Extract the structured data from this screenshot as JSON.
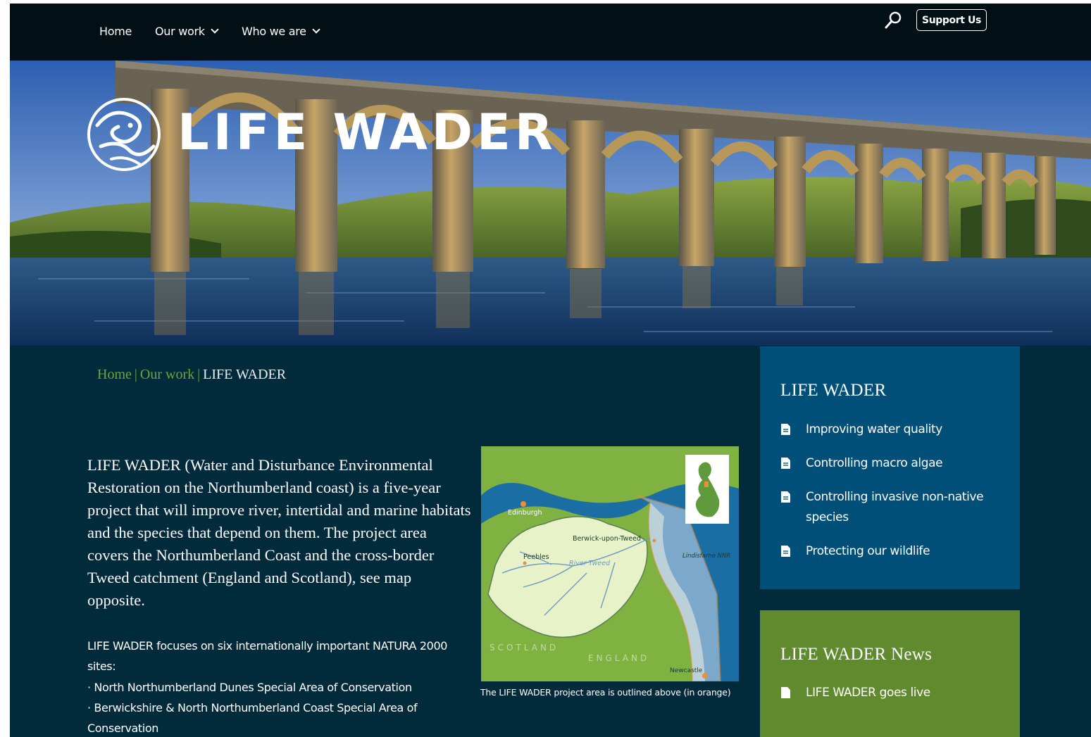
{
  "nav": {
    "home": "Home",
    "our_work": "Our work",
    "who_we_are": "Who we are",
    "support": "Support Us"
  },
  "hero": {
    "title": "LIFE WADER"
  },
  "breadcrumb": {
    "home": "Home",
    "our_work": "Our work",
    "current": "LIFE WADER",
    "separator": "|"
  },
  "intro": {
    "paragraph": "LIFE WADER (Water and Disturbance Environmental Restoration on the Northumberland coast) is a five-year project that will improve river, intertidal and marine habitats and the species that depend on them. The project area covers the Northumberland Coast and the cross-border Tweed catchment (England and Scotland), see map opposite.",
    "focus": "LIFE WADER focuses on six internationally important NATURA 2000 sites:",
    "sites": [
      "North Northumberland Dunes Special Area of Conservation",
      "Berwickshire & North Northumberland Coast Special Area of Conservation"
    ]
  },
  "map": {
    "labels": {
      "edinburgh": "Edinburgh",
      "berwick": "Berwick-upon-Tweed",
      "peebles": "Peebles",
      "river": "River Tweed",
      "lindisfarne": "Lindisfarne NNR",
      "scotland": "SCOTLAND",
      "england": "ENGLAND",
      "newcastle": "Newcastle"
    },
    "caption": "The LIFE WADER project area is outlined above (in orange)"
  },
  "sidebar": {
    "title": "LIFE WADER",
    "items": [
      "Improving water quality",
      "Controlling macro algae",
      "Controlling invasive non-native species",
      "Protecting our wildlife"
    ]
  },
  "news": {
    "title": "LIFE WADER News",
    "items": [
      "LIFE WADER goes live"
    ]
  },
  "colors": {
    "page_bg": "#012a3a",
    "nav_bg": "#020f14",
    "sidebar_blue": "#004f78",
    "news_green": "#5f8b2e",
    "link_green": "#74a33a"
  },
  "icons": {
    "search": "search-icon",
    "chevron": "chevron-down-icon",
    "document": "document-icon",
    "logo": "wader-logo-icon"
  }
}
